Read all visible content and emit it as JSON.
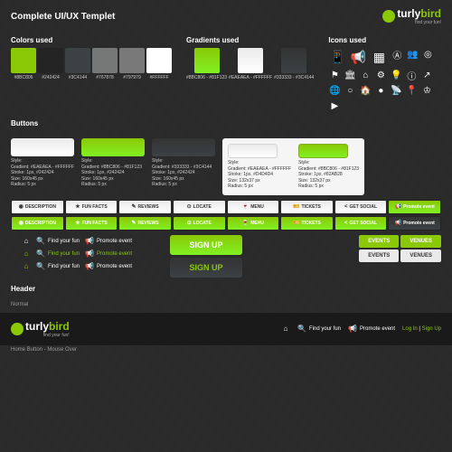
{
  "page_title": "Complete UI/UX Templet",
  "brand": {
    "name1": "turly",
    "name2": "bird",
    "tagline": "find your fun!"
  },
  "sections": {
    "colors": "Colors used",
    "gradients": "Gradients used",
    "icons": "Icons used",
    "buttons": "Buttons",
    "header": "Header",
    "normal": "Normal",
    "home_mouse": "Home Button - Mouse Over"
  },
  "colors": [
    {
      "hex": "#8BC806",
      "label": "#8BC806"
    },
    {
      "hex": "#242424",
      "label": "#242424"
    },
    {
      "hex": "#3C4144",
      "label": "#3C4144"
    },
    {
      "hex": "#767878",
      "label": "#767878"
    },
    {
      "hex": "#797979",
      "label": "#797979"
    },
    {
      "hex": "#FFFFFF",
      "label": "#FFFFFF"
    }
  ],
  "gradients": [
    {
      "from": "#8BC806",
      "to": "#81F123",
      "label": "#8BC806 - #81F123"
    },
    {
      "from": "#EAEAEA",
      "to": "#FFFFFF",
      "label": "#EAEAEA - #FFFFFF"
    },
    {
      "from": "#333333",
      "to": "#3C4144",
      "label": "#333333 - #3C4144"
    }
  ],
  "button_specs": [
    {
      "style": "Style:",
      "gradient": "Gradient: #EAEAEA - #FFFFFF",
      "stroke": "Stroke: 1px, #242424",
      "size": "Size: 160x45 px",
      "radius": "Radius: 5 px"
    },
    {
      "style": "Style:",
      "gradient": "Gradient: #8BC806 - #81F123",
      "stroke": "Stroke: 1px, #242424",
      "size": "Size: 160x45 px",
      "radius": "Radius: 5 px"
    },
    {
      "style": "Style:",
      "gradient": "Gradient: #333333 - #3C4144",
      "stroke": "Stroke: 1px, #242424",
      "size": "Size: 160x45 px",
      "radius": "Radius: 5 px"
    },
    {
      "style": "Style:",
      "gradient": "Gradient: #EAEAEA - #FFFFFF",
      "stroke": "Stroke: 1px, #D4D4D4",
      "size": "Size: 132x37 px",
      "radius": "Radius: 5 px"
    },
    {
      "style": "Style:",
      "gradient": "Gradient: #8BC806 - #81F123",
      "stroke": "Stroke: 1px, #82AB28",
      "size": "Size: 132x37 px",
      "radius": "Radius: 5 px"
    }
  ],
  "nav": [
    {
      "icon": "◉",
      "label": "DESCRIPTION"
    },
    {
      "icon": "★",
      "label": "FUN FACTS"
    },
    {
      "icon": "✎",
      "label": "REVIEWS"
    },
    {
      "icon": "⊙",
      "label": "LOCATE"
    },
    {
      "icon": "🍷",
      "label": "MENU"
    },
    {
      "icon": "🎫",
      "label": "TICKETS"
    },
    {
      "icon": "<",
      "label": "GET SOCIAL"
    },
    {
      "icon": "📢",
      "label": "Promote event"
    }
  ],
  "actions": {
    "home": "⌂",
    "find": "Find your fun",
    "promote": "Promote event",
    "find_icon": "🔍",
    "promote_icon": "📢"
  },
  "signup": "SIGN UP",
  "tabs": {
    "events": "EVENTS",
    "venues": "VENUES"
  },
  "header_bar": {
    "login": "Log In",
    "signup": "Sign Up",
    "sep": " | "
  }
}
